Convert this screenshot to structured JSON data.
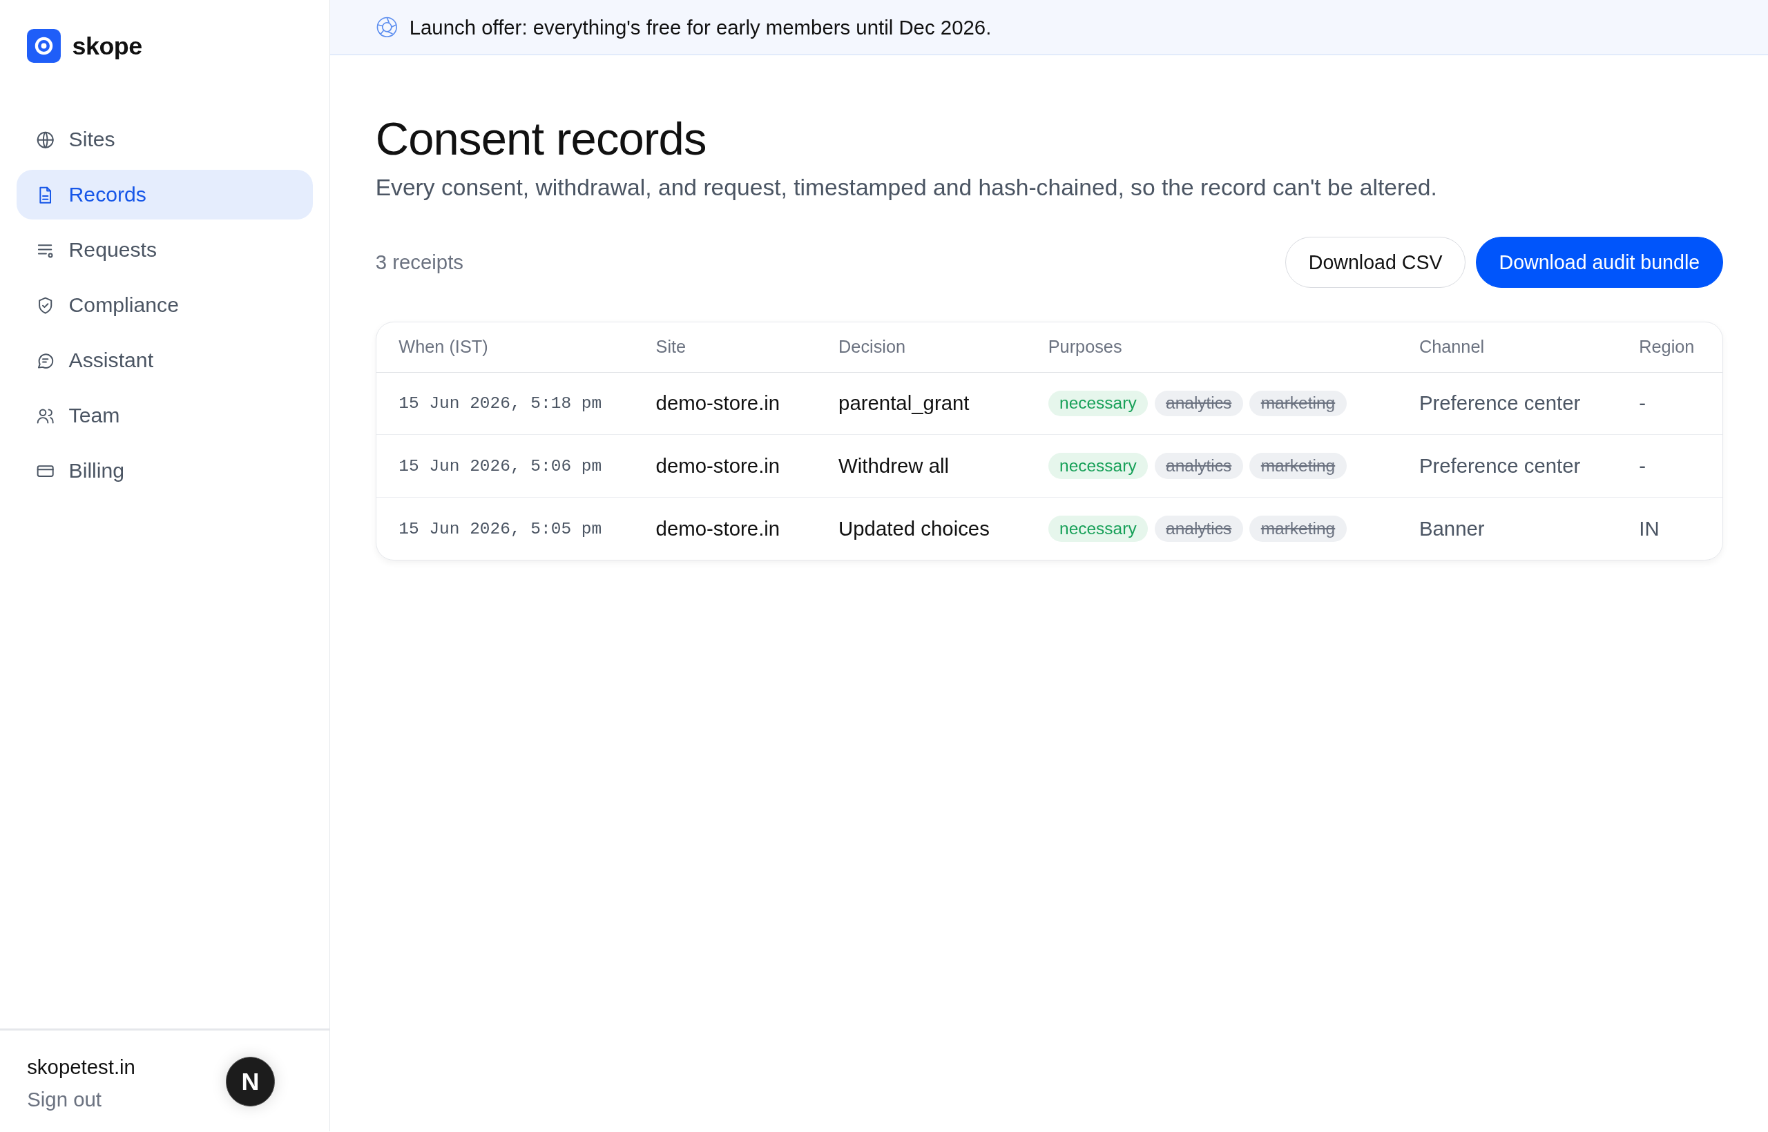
{
  "brand": {
    "name": "skope"
  },
  "sidebar": {
    "items": [
      {
        "label": "Sites",
        "selected": false
      },
      {
        "label": "Records",
        "selected": true
      },
      {
        "label": "Requests",
        "selected": false
      },
      {
        "label": "Compliance",
        "selected": false
      },
      {
        "label": "Assistant",
        "selected": false
      },
      {
        "label": "Team",
        "selected": false
      },
      {
        "label": "Billing",
        "selected": false
      }
    ],
    "account": {
      "name": "skopetest.in",
      "sign_out": "Sign out"
    }
  },
  "dev_indicator": {
    "label": "N"
  },
  "banner": {
    "text": "Launch offer: everything's free for early members until Dec 2026."
  },
  "page": {
    "title": "Consent records",
    "subtitle": "Every consent, withdrawal, and request, timestamped and hash-chained, so the record can't be altered.",
    "count": "3 receipts"
  },
  "buttons": [
    {
      "label": "Download CSV",
      "kind": "secondary"
    },
    {
      "label": "Download audit bundle",
      "kind": "primary"
    }
  ],
  "table": {
    "columns": [
      "When (IST)",
      "Site",
      "Decision",
      "Purposes",
      "Channel",
      "Region"
    ],
    "rows": [
      {
        "when": "15 Jun 2026, 5:18 pm",
        "site": "demo-store.in",
        "decision": "parental_grant",
        "purposes": [
          {
            "label": "necessary",
            "granted": true
          },
          {
            "label": "analytics",
            "granted": false
          },
          {
            "label": "marketing",
            "granted": false
          }
        ],
        "channel": "Preference center",
        "region": "-"
      },
      {
        "when": "15 Jun 2026, 5:06 pm",
        "site": "demo-store.in",
        "decision": "Withdrew all",
        "purposes": [
          {
            "label": "necessary",
            "granted": true
          },
          {
            "label": "analytics",
            "granted": false
          },
          {
            "label": "marketing",
            "granted": false
          }
        ],
        "channel": "Preference center",
        "region": "-"
      },
      {
        "when": "15 Jun 2026, 5:05 pm",
        "site": "demo-store.in",
        "decision": "Updated choices",
        "purposes": [
          {
            "label": "necessary",
            "granted": true
          },
          {
            "label": "analytics",
            "granted": false
          },
          {
            "label": "marketing",
            "granted": false
          }
        ],
        "channel": "Banner",
        "region": "IN"
      }
    ]
  }
}
